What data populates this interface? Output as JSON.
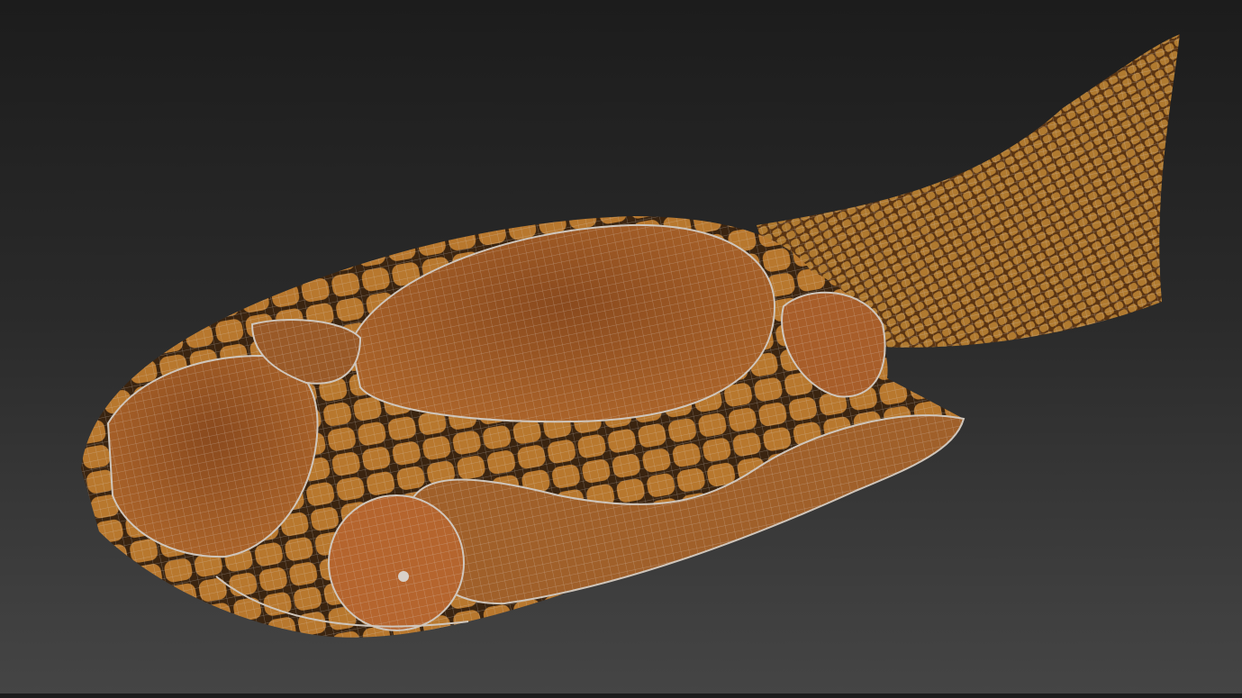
{
  "viewport": {
    "background_top": "#1c1c1c",
    "background_bottom": "#454545"
  },
  "model": {
    "subject": "armored fish",
    "colors": {
      "body": "#8a4e1c",
      "plate": "#9a5526",
      "scales": "#b8782e",
      "tail": "#a8702a",
      "wire": "#d8d0c8",
      "seam": "#3a2410"
    }
  }
}
